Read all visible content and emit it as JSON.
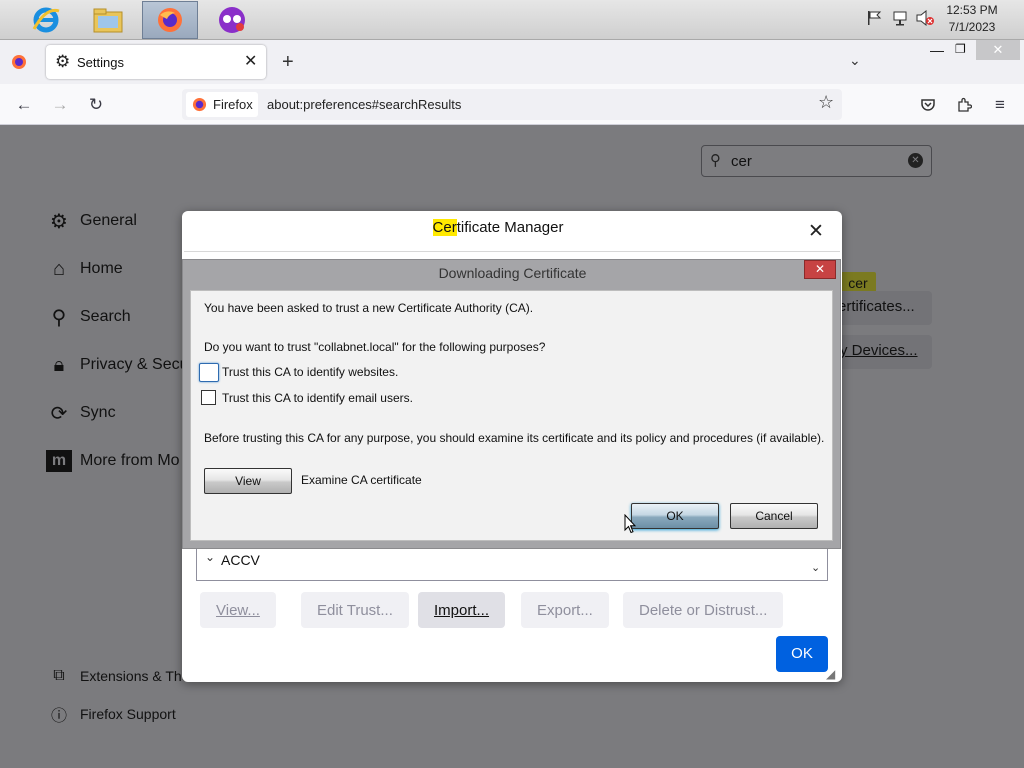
{
  "taskbar": {
    "clock_time": "12:53 PM",
    "clock_date": "7/1/2023"
  },
  "browser": {
    "tab_title": "Settings",
    "url_identity": "Firefox",
    "url": "about:preferences#searchResults"
  },
  "settings": {
    "search_value": "cer",
    "sidebar": [
      {
        "label": "General",
        "icon": "gear-icon"
      },
      {
        "label": "Home",
        "icon": "home-icon"
      },
      {
        "label": "Search",
        "icon": "search-icon"
      },
      {
        "label": "Privacy & Secu",
        "icon": "lock-icon"
      },
      {
        "label": "Sync",
        "icon": "sync-icon"
      },
      {
        "label": "More from Mo",
        "icon": "mozilla-icon"
      }
    ],
    "footer_links": [
      {
        "label": "Extensions & The",
        "icon": "puzzle-icon"
      },
      {
        "label": "Firefox Support",
        "icon": "help-icon"
      }
    ],
    "highlight_tag": "cer",
    "view_certificates_partial": "ertificates...",
    "security_devices_partial": "y Devices..."
  },
  "cert_manager": {
    "title_highlight": "Cer",
    "title_rest": "tificate Manager",
    "list_item": "ACCV",
    "buttons": {
      "view": "View...",
      "edit_trust": "Edit Trust...",
      "import": "Import...",
      "export": "Export...",
      "delete": "Delete or Distrust...",
      "ok": "OK"
    }
  },
  "download_dialog": {
    "title": "Downloading Certificate",
    "line1": "You have been asked to trust a new Certificate Authority (CA).",
    "line2": "Do you want to trust \"collabnet.local\" for the following purposes?",
    "check_websites": "Trust this CA to identify websites.",
    "check_email": "Trust this CA to identify email users.",
    "line3": "Before trusting this CA for any purpose, you should examine its certificate and its policy and procedures (if available).",
    "view_button": "View",
    "view_desc": "Examine CA certificate",
    "ok_button": "OK",
    "cancel_button": "Cancel",
    "checked_websites": false,
    "checked_email": false
  },
  "colors": {
    "accent": "#0061e0",
    "highlight": "#ffe900",
    "close_red": "#c74343"
  }
}
